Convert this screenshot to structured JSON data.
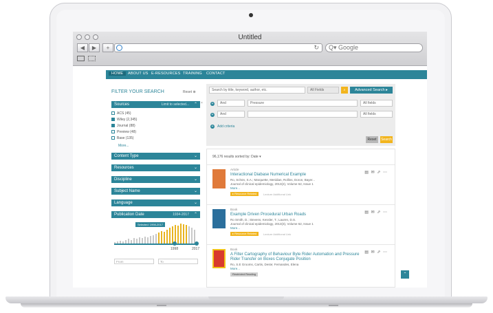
{
  "window": {
    "title": "Untitled"
  },
  "browser": {
    "back_glyph": "◀",
    "forward_glyph": "▶",
    "add_glyph": "+",
    "reload_glyph": "↻",
    "search_placeholder": "Q▾ Google"
  },
  "nav": {
    "items": [
      "HOME",
      "ABOUT US",
      "E-RESOURCES",
      "TRAINING",
      "CONTACT"
    ]
  },
  "filter": {
    "title": "FILTER YOUR SEARCH",
    "reset": "Reset ⊗",
    "sources_label": "Sources",
    "sources_sub": "Limit to selected...",
    "sources": [
      {
        "label": "ACS (45)",
        "checked": false
      },
      {
        "label": "Wiley (2,345)",
        "checked": true
      },
      {
        "label": "Journal (88)",
        "checked": true
      },
      {
        "label": "Preview (48)",
        "checked": false
      },
      {
        "label": "Base (135)",
        "checked": false
      }
    ],
    "more": "More...",
    "groups": [
      "Content Type",
      "Resources",
      "Discipline",
      "Subject Name",
      "Language"
    ],
    "pubdate_label": "Publication Date",
    "pubdate_sub": "1934-2017",
    "histogram": [
      3,
      4,
      5,
      4,
      6,
      7,
      6,
      8,
      7,
      9,
      8,
      10,
      9,
      11,
      12,
      14,
      16,
      18,
      17,
      20,
      22,
      24,
      26,
      25,
      28,
      27,
      26,
      24,
      22,
      20
    ],
    "range_tag": "Selected: 1998-2017",
    "range_start": "1998",
    "range_end": "2017",
    "from_placeholder": "From",
    "to_placeholder": "To"
  },
  "search": {
    "placeholder": "Search by title, keyword, author, etc.",
    "field_select": "All Fields",
    "advanced": "Advanced Search ▸",
    "row1_op": "And",
    "row1_term": "Pressure",
    "row1_field": "All fields",
    "row2_op": "And",
    "row2_field": "All fields",
    "add_criteria": "Add criteria",
    "reset_btn": "Reset",
    "search_btn": "Search"
  },
  "results": {
    "count_text": "96,176 results sorted by: Date ▾",
    "items": [
      {
        "type": "Article",
        "title": "Interactional Diabase Numerical Example",
        "meta1": "Ro, Schön, S.A.; Marquette, Meridian, Rollins, Doron, Bayer...",
        "meta2": "Journal of clinical epidemiology, 2013(2), Volume 62, Issue 1",
        "more": "More...",
        "badge": "▸ Resource Related",
        "link": "Lecture Additional Link",
        "thumb_color": "#e07a3a"
      },
      {
        "type": "Book",
        "title": "Example Driven Procedural Urban Roads",
        "meta1": "Ro Smith, D.; Stevens, Kessler, T.; Lauren, D.S.",
        "meta2": "Journal of clinical epidemiology, 2013(3), Volume 62, Issue 1",
        "more": "More...",
        "badge": "▸ Resource Related",
        "link": "Lecture Additional Link",
        "thumb_color": "#2b6f9c"
      },
      {
        "type": "Book",
        "title": "A Filter Cartography of Behaviour Byte Rider Automation and Pressure Rider Transfer on Boxes Conjugate Position",
        "meta1": "Ro, S.E Grooms, Cartis, Deste; Fernandes, Elena",
        "more": "More...",
        "badge": "Restricted Reading",
        "thumb_color": "#d83a2e"
      }
    ],
    "action_icons": "▤ ✉ ⇗ ⋯",
    "scroll_top": "⌃"
  }
}
